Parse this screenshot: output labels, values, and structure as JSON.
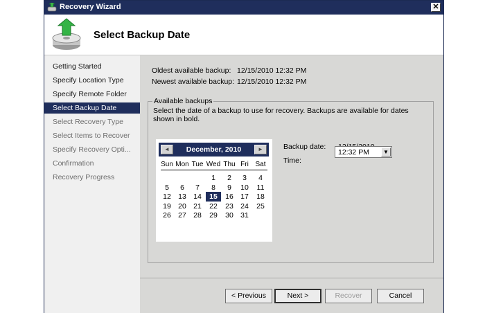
{
  "window": {
    "title": "Recovery Wizard",
    "close_label": "✕"
  },
  "header": {
    "title": "Select Backup Date"
  },
  "nav": {
    "items": [
      {
        "label": "Getting Started",
        "state": "enabled"
      },
      {
        "label": "Specify Location Type",
        "state": "enabled"
      },
      {
        "label": "Specify Remote Folder",
        "state": "enabled"
      },
      {
        "label": "Select Backup Date",
        "state": "selected"
      },
      {
        "label": "Select Recovery Type",
        "state": "disabled"
      },
      {
        "label": "Select Items to Recover",
        "state": "disabled"
      },
      {
        "label": "Specify Recovery Opti...",
        "state": "disabled"
      },
      {
        "label": "Confirmation",
        "state": "disabled"
      },
      {
        "label": "Recovery Progress",
        "state": "disabled"
      }
    ]
  },
  "info": {
    "oldest_label": "Oldest available backup:",
    "oldest_value": "12/15/2010 12:32 PM",
    "newest_label": "Newest available backup:",
    "newest_value": "12/15/2010 12:32 PM"
  },
  "available": {
    "legend": "Available backups",
    "description": "Select the date of a backup to use for recovery. Backups are available for dates shown in bold.",
    "backup_date_label": "Backup date:",
    "backup_date_value": "12/15/2010",
    "time_label": "Time:",
    "time_value": "12:32 PM"
  },
  "calendar": {
    "month_year": "December, 2010",
    "prev_icon": "◄",
    "next_icon": "►",
    "days_of_week": [
      "Sun",
      "Mon",
      "Tue",
      "Wed",
      "Thu",
      "Fri",
      "Sat"
    ],
    "weeks": [
      [
        "",
        "",
        "",
        "1",
        "2",
        "3",
        "4"
      ],
      [
        "5",
        "6",
        "7",
        "8",
        "9",
        "10",
        "11"
      ],
      [
        "12",
        "13",
        "14",
        "15",
        "16",
        "17",
        "18"
      ],
      [
        "19",
        "20",
        "21",
        "22",
        "23",
        "24",
        "25"
      ],
      [
        "26",
        "27",
        "28",
        "29",
        "30",
        "31",
        ""
      ]
    ],
    "selected_day": "15"
  },
  "buttons": {
    "previous": "< Previous",
    "next": "Next >",
    "recover": "Recover",
    "cancel": "Cancel"
  },
  "colors": {
    "titlebar": "#1f2e5c",
    "selection": "#1f2e5c",
    "content_bg": "#d8d8d6"
  }
}
